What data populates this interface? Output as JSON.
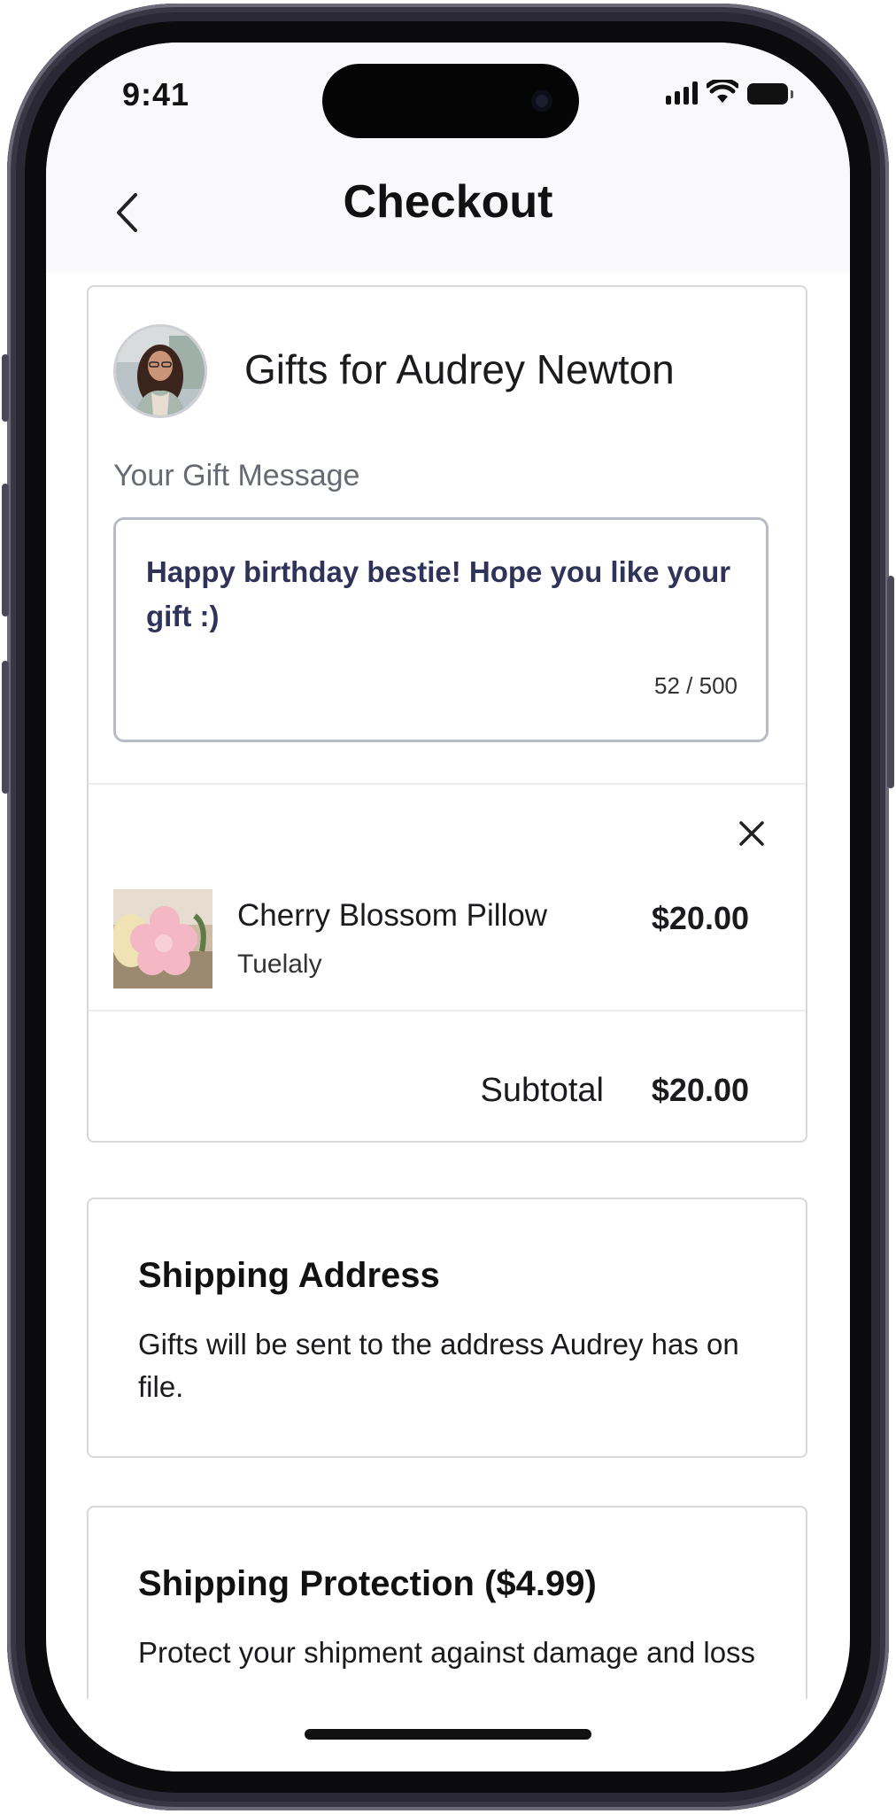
{
  "status_bar": {
    "time": "9:41"
  },
  "header": {
    "title": "Checkout"
  },
  "gift": {
    "heading": "Gifts for Audrey Newton",
    "message_label": "Your Gift Message",
    "message": "Happy birthday bestie! Hope you like your gift :)",
    "char_count": "52 / 500"
  },
  "item": {
    "name": "Cherry Blossom Pillow",
    "brand": "Tuelaly",
    "price": "$20.00"
  },
  "summary": {
    "subtotal_label": "Subtotal",
    "subtotal_value": "$20.00"
  },
  "shipping": {
    "title": "Shipping Address",
    "body": "Gifts will be sent to the address Audrey has on file."
  },
  "protection": {
    "title": "Shipping Protection ($4.99)",
    "body": "Protect your shipment against damage and loss"
  },
  "icons": {
    "back": "chevron-left-icon",
    "close": "close-icon",
    "signal": "cellular-signal-icon",
    "wifi": "wifi-icon",
    "battery": "battery-icon"
  },
  "colors": {
    "message_text": "#2f3259",
    "border": "#d7d7dc",
    "header_bg": "#f9f9fb"
  }
}
